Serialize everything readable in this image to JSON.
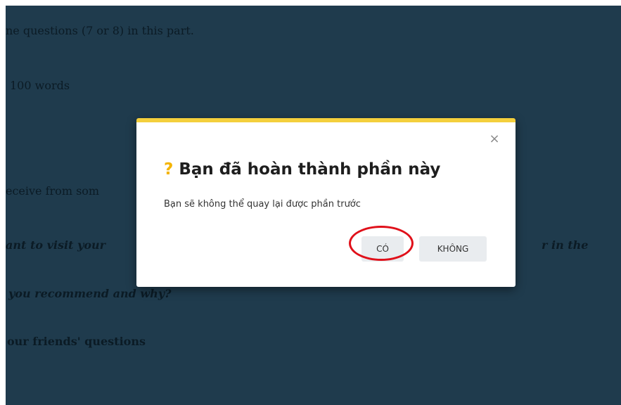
{
  "background_text": {
    "line1": "ne questions (7 or 8) in this part.",
    "line2": "100 words",
    "line3": "eceive from som",
    "line4_left": "ant to visit your",
    "line4_right": "r in the",
    "line5": "you recommend and why?",
    "line6": "our friends' questions"
  },
  "dialog": {
    "icon": "?",
    "title": "Bạn đã hoàn thành phần này",
    "message": "Bạn sẽ không thể quay lại được phần trước",
    "close_icon": "×",
    "yes_label": "CÓ",
    "no_label": "KHÔNG"
  },
  "colors": {
    "overlay": "#1f3b4d",
    "accent_bar": "#f4cf3c",
    "question_icon": "#f4b400",
    "highlight_circle": "#e0101a"
  }
}
